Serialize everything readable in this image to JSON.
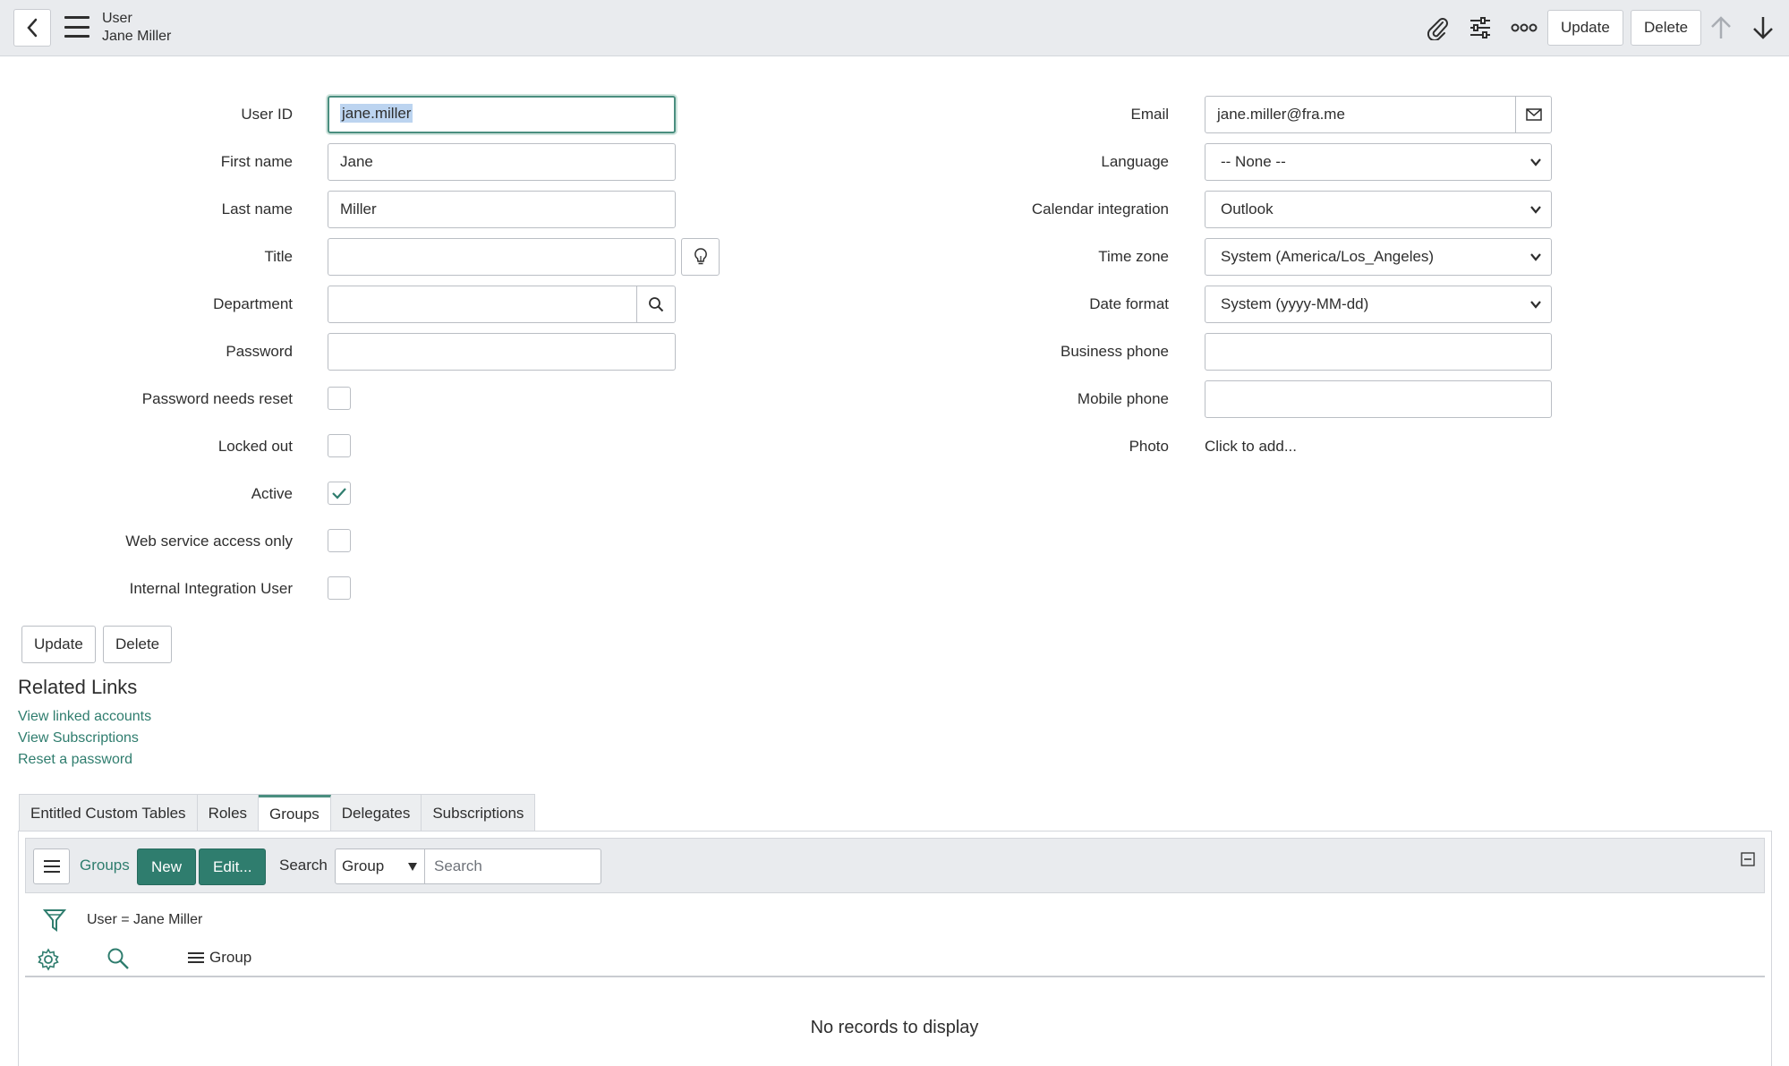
{
  "header": {
    "table_name": "User",
    "record_name": "Jane Miller",
    "update_label": "Update",
    "delete_label": "Delete",
    "icons": [
      "back-icon",
      "menu-icon",
      "paperclip-icon",
      "sliders-icon",
      "more-icon",
      "arrow-up-icon",
      "arrow-down-icon"
    ]
  },
  "form": {
    "left": {
      "user_id_label": "User ID",
      "user_id_value": "jane.miller",
      "first_name_label": "First name",
      "first_name_value": "Jane",
      "last_name_label": "Last name",
      "last_name_value": "Miller",
      "title_label": "Title",
      "title_value": "",
      "department_label": "Department",
      "department_value": "",
      "password_label": "Password",
      "password_value": "",
      "password_reset_label": "Password needs reset",
      "password_reset_checked": false,
      "locked_out_label": "Locked out",
      "locked_out_checked": false,
      "active_label": "Active",
      "active_checked": true,
      "web_service_label": "Web service access only",
      "web_service_checked": false,
      "internal_integration_label": "Internal Integration User",
      "internal_integration_checked": false
    },
    "right": {
      "email_label": "Email",
      "email_value": "jane.miller@fra.me",
      "language_label": "Language",
      "language_value": "-- None --",
      "calendar_label": "Calendar integration",
      "calendar_value": "Outlook",
      "timezone_label": "Time zone",
      "timezone_value": "System (America/Los_Angeles)",
      "date_format_label": "Date format",
      "date_format_value": "System (yyyy-MM-dd)",
      "business_phone_label": "Business phone",
      "business_phone_value": "",
      "mobile_phone_label": "Mobile phone",
      "mobile_phone_value": "",
      "photo_label": "Photo",
      "photo_value": "Click to add..."
    },
    "update_label": "Update",
    "delete_label": "Delete"
  },
  "related_links": {
    "title": "Related Links",
    "links": [
      "View linked accounts",
      "View Subscriptions",
      "Reset a password"
    ]
  },
  "tabs": [
    {
      "label": "Entitled Custom Tables",
      "active": false
    },
    {
      "label": "Roles",
      "active": false
    },
    {
      "label": "Groups",
      "active": true
    },
    {
      "label": "Delegates",
      "active": false
    },
    {
      "label": "Subscriptions",
      "active": false
    }
  ],
  "related_list": {
    "title": "Groups",
    "new_label": "New",
    "edit_label": "Edit...",
    "search_label": "Search",
    "search_field": "Group",
    "search_placeholder": "Search",
    "filter": "User = Jane Miller",
    "column": "Group",
    "empty_message": "No records to display"
  },
  "colors": {
    "accent": "#2f7d6e",
    "header_bg": "#e9ebee"
  }
}
